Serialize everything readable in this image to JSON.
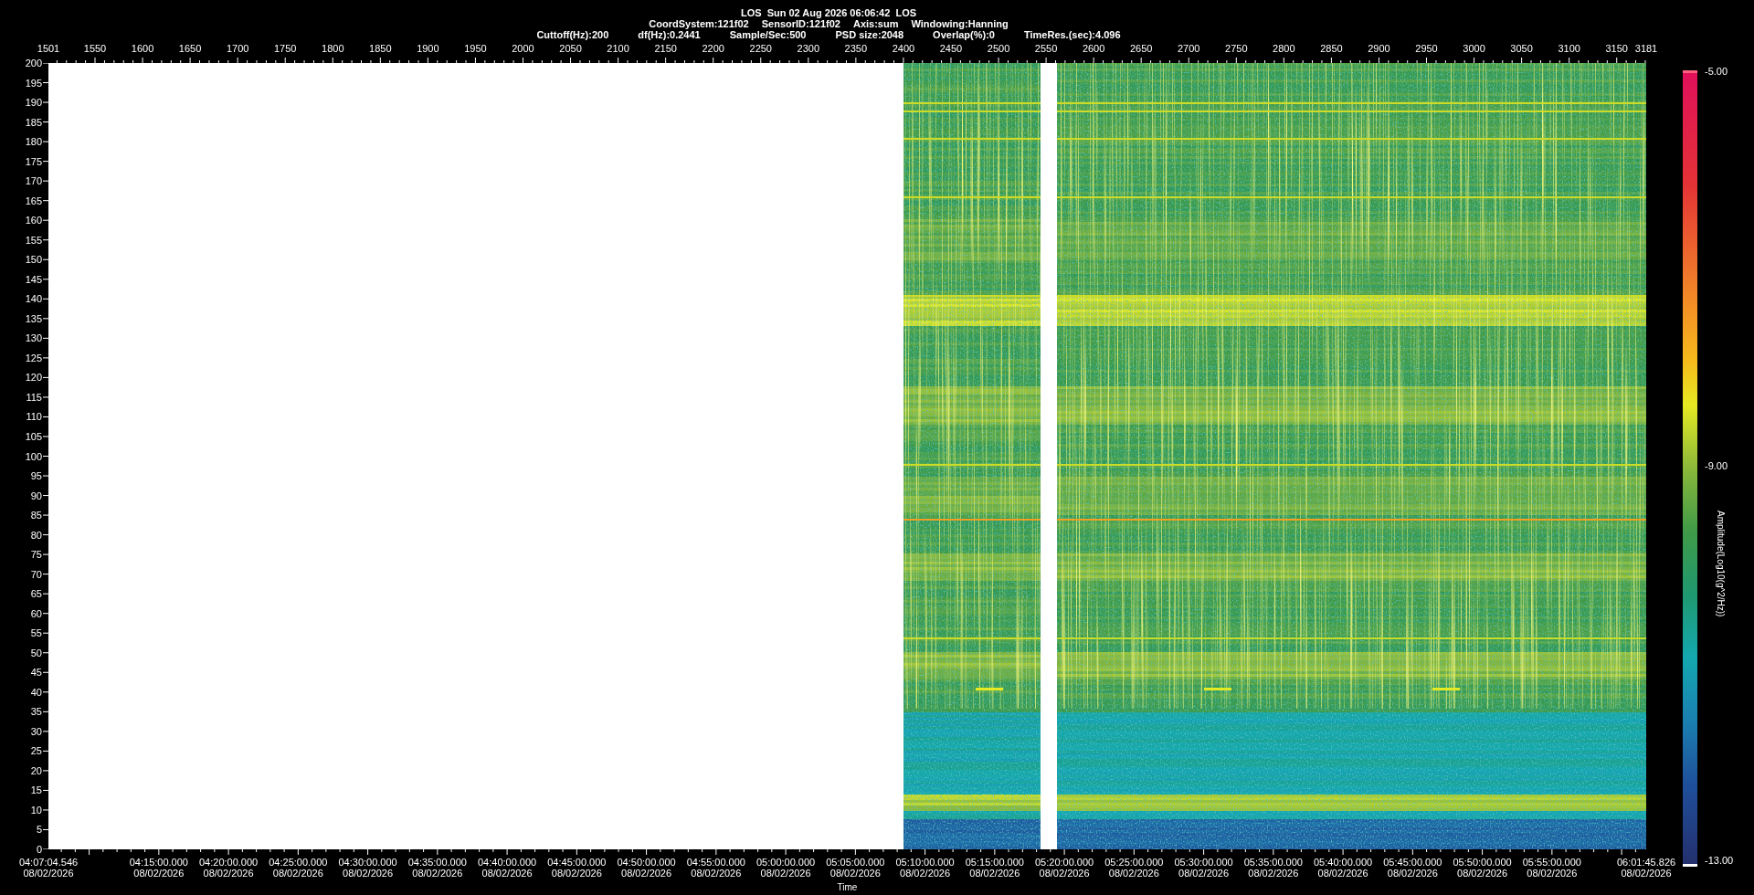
{
  "header": {
    "title": "LOS  Sun 02 Aug 2026 06:06:42  LOS",
    "line_2": [
      "CoordSystem:121f02",
      "SensorID:121f02",
      "Axis:sum",
      "Windowing:Hanning"
    ],
    "line_3": [
      "Cuttoff(Hz):200",
      "df(Hz):0.2441",
      "Sample/Sec:500",
      "PSD size:2048",
      "Overlap(%):0",
      "TimeRes.(sec):4.096"
    ]
  },
  "top_axis": {
    "ticks": [
      "1501",
      "1550",
      "1600",
      "1650",
      "1700",
      "1750",
      "1800",
      "1850",
      "1900",
      "1950",
      "2000",
      "2050",
      "2100",
      "2150",
      "2200",
      "2250",
      "2300",
      "2350",
      "2400",
      "2450",
      "2500",
      "2550",
      "2600",
      "2650",
      "2700",
      "2750",
      "2800",
      "2850",
      "2900",
      "2950",
      "3000",
      "3050",
      "3100",
      "3150",
      "3181"
    ]
  },
  "y_axis": {
    "ticks": [
      "200",
      "195",
      "190",
      "185",
      "180",
      "175",
      "170",
      "165",
      "160",
      "155",
      "150",
      "145",
      "140",
      "135",
      "130",
      "125",
      "120",
      "115",
      "110",
      "105",
      "100",
      "95",
      "90",
      "85",
      "80",
      "75",
      "70",
      "65",
      "60",
      "55",
      "50",
      "45",
      "40",
      "35",
      "30",
      "25",
      "20",
      "15",
      "10",
      "5",
      "0"
    ]
  },
  "time_axis": {
    "title": "Time",
    "ticks": [
      {
        "time": "04:07:04.546",
        "date": "08/02/2026"
      },
      {
        "time": "04:15:00.000",
        "date": "08/02/2026"
      },
      {
        "time": "04:20:00.000",
        "date": "08/02/2026"
      },
      {
        "time": "04:25:00.000",
        "date": "08/02/2026"
      },
      {
        "time": "04:30:00.000",
        "date": "08/02/2026"
      },
      {
        "time": "04:35:00.000",
        "date": "08/02/2026"
      },
      {
        "time": "04:40:00.000",
        "date": "08/02/2026"
      },
      {
        "time": "04:45:00.000",
        "date": "08/02/2026"
      },
      {
        "time": "04:50:00.000",
        "date": "08/02/2026"
      },
      {
        "time": "04:55:00.000",
        "date": "08/02/2026"
      },
      {
        "time": "05:00:00.000",
        "date": "08/02/2026"
      },
      {
        "time": "05:05:00.000",
        "date": "08/02/2026"
      },
      {
        "time": "05:10:00.000",
        "date": "08/02/2026"
      },
      {
        "time": "05:15:00.000",
        "date": "08/02/2026"
      },
      {
        "time": "05:20:00.000",
        "date": "08/02/2026"
      },
      {
        "time": "05:25:00.000",
        "date": "08/02/2026"
      },
      {
        "time": "05:30:00.000",
        "date": "08/02/2026"
      },
      {
        "time": "05:35:00.000",
        "date": "08/02/2026"
      },
      {
        "time": "05:40:00.000",
        "date": "08/02/2026"
      },
      {
        "time": "05:45:00.000",
        "date": "08/02/2026"
      },
      {
        "time": "05:50:00.000",
        "date": "08/02/2026"
      },
      {
        "time": "05:55:00.000",
        "date": "08/02/2026"
      },
      {
        "time": "06:01:45.826",
        "date": "08/02/2026"
      }
    ]
  },
  "colorbar": {
    "title": "Amplitude(Log10(g^2/Hz))",
    "labels": [
      "-5.00",
      "-9.00",
      "-13.00"
    ]
  }
}
